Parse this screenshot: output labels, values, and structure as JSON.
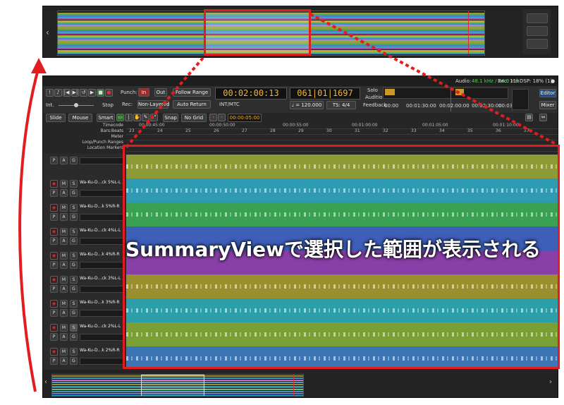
{
  "summary_top": {
    "lines": [
      "#9a9a3a",
      "#44aa55",
      "#5577cc",
      "#33aabb",
      "#aa44aa",
      "#ccaa33",
      "#66bb66",
      "#4488cc",
      "#aa88cc",
      "#88aa33"
    ]
  },
  "status": {
    "audio": "Audio:",
    "audio_value": "48.1 kHz / 24.0 ms",
    "rec": "Rec: 11h",
    "dsp": "DSP: 18% (1)"
  },
  "transport": {
    "punch_label": "Punch:",
    "punch_in": "In",
    "punch_out": "Out",
    "int_label": "Int.",
    "stop_label": "Stop",
    "rec_label": "Rec:",
    "rec_mode": "Non-Layered",
    "follow_range": "Follow Range",
    "auto_return": "Auto Return",
    "timecode_main": "00:02:00:13",
    "int_mtc": "INT/MTC",
    "bars_beats": "061|01|1697",
    "tempo": "♩ = 120.000",
    "ts": "TS: 4/4",
    "solo": "Solo",
    "audition": "Audition",
    "feedback": "Feedback",
    "editor": "Editor",
    "mixer": "Mixer",
    "mini_ruler": [
      "00:00",
      "00:01:30:00",
      "00:02:00:00",
      "00:02:30:00",
      "00:03"
    ]
  },
  "toolbar": {
    "slide": "Slide",
    "mouse": "Mouse",
    "smart": "Smart",
    "snap": "Snap",
    "no_grid": "No Grid",
    "nudge": "00:00:05:00"
  },
  "rulers": {
    "timecode": "Timecode",
    "bars_beats": "Bars:Beats",
    "meter": "Meter",
    "loop_punch": "Loop/Punch Ranges",
    "location": "Location Markers",
    "timecode_ticks": [
      "00:00:45:00",
      "00:00:50:00",
      "00:00:55:00",
      "00:01:00:00",
      "00:01:05:00",
      "00:01:10:00"
    ],
    "bar_ticks": [
      "23",
      "24",
      "25",
      "26",
      "27",
      "28",
      "29",
      "30",
      "31",
      "32",
      "33",
      "34",
      "35",
      "36",
      "37"
    ]
  },
  "tracks": [
    {
      "name": "",
      "color": "#8e9a35",
      "rec": false,
      "solo": false
    },
    {
      "name": "Wa-Ku-D...ck 5%L-L",
      "color": "#2f9bb2",
      "rec": true,
      "solo": false
    },
    {
      "name": "Wa-Ku-D...k 5%R-R",
      "color": "#3aa052",
      "rec": true,
      "solo": false
    },
    {
      "name": "Wa-Ku-D...ck 4%L-L",
      "color": "#3d5fb8",
      "rec": true,
      "solo": false
    },
    {
      "name": "Wa-Ku-D...k 4%R-R",
      "color": "#8a3fa8",
      "rec": true,
      "solo": false
    },
    {
      "name": "Wa-Ku-D...ck 3%L-L",
      "color": "#9a8e2e",
      "rec": true,
      "solo": false
    },
    {
      "name": "Wa-Ku-D...k 3%R-R",
      "color": "#2b9ea8",
      "rec": true,
      "solo": false
    },
    {
      "name": "Wa-Ku-D...ck 2%L-L",
      "color": "#7aa035",
      "rec": true,
      "solo": true
    },
    {
      "name": "Wa-Ku-D...k 2%R-R",
      "color": "#3b75b4",
      "rec": true,
      "solo": false
    }
  ],
  "mini_labels": {
    "m": "M",
    "s": "S",
    "p": "P",
    "a": "A",
    "g": "G"
  },
  "caption": "SummaryViewで選択した範囲が表示される",
  "summary_bottom": {
    "lines": [
      "#9a9a3a",
      "#44aa55",
      "#5577cc",
      "#33aabb",
      "#aa44aa",
      "#ccaa33",
      "#66bb66",
      "#4488cc"
    ]
  },
  "colors": {
    "annotation": "#e21d1d",
    "lcd_text": "#f2b330"
  }
}
